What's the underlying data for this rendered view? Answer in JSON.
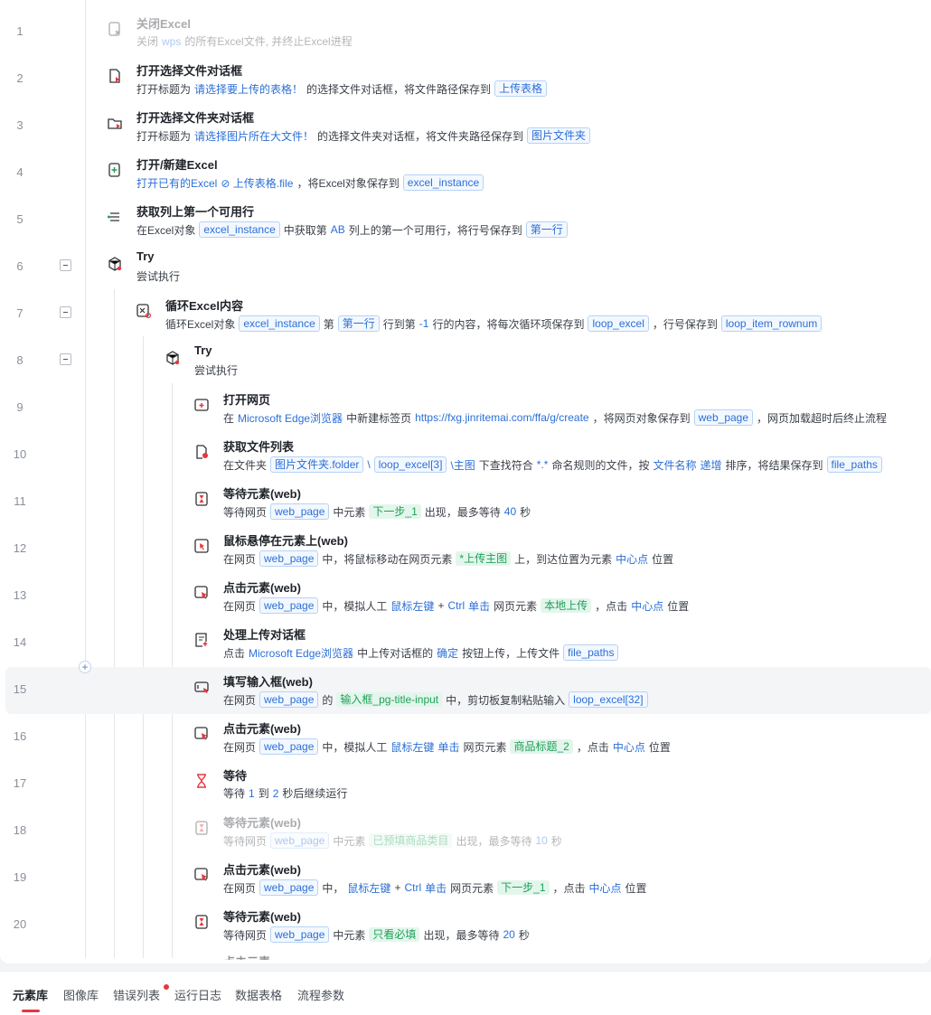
{
  "colors": {
    "variable": "#2b6fd6",
    "element": "#20a05a",
    "accent": "#e8363e"
  },
  "rows": [
    {
      "num": "1",
      "icon": "excel-close-icon",
      "title": "关闭Excel",
      "disabled": true,
      "desc": [
        {
          "t": "text",
          "v": "关闭"
        },
        {
          "t": "kw",
          "v": "wps"
        },
        {
          "t": "text",
          "v": "的所有Excel文件, 并终止Excel进程"
        }
      ]
    },
    {
      "num": "2",
      "icon": "file-dialog-icon",
      "title": "打开选择文件对话框",
      "desc": [
        {
          "t": "text",
          "v": "打开标题为"
        },
        {
          "t": "kw",
          "v": "请选择要上传的表格！"
        },
        {
          "t": "text",
          "v": "的选择文件对话框，将文件路径保存到"
        },
        {
          "t": "var",
          "v": "上传表格"
        }
      ]
    },
    {
      "num": "3",
      "icon": "folder-dialog-icon",
      "title": "打开选择文件夹对话框",
      "desc": [
        {
          "t": "text",
          "v": "打开标题为"
        },
        {
          "t": "kw",
          "v": "请选择图片所在大文件！"
        },
        {
          "t": "text",
          "v": "的选择文件夹对话框，将文件夹路径保存到"
        },
        {
          "t": "var",
          "v": "图片文件夹"
        }
      ]
    },
    {
      "num": "4",
      "icon": "excel-open-icon",
      "title": "打开/新建Excel",
      "desc": [
        {
          "t": "kw",
          "v": "打开已有的Excel"
        },
        {
          "t": "kw",
          "v": "⊘ 上传表格.file"
        },
        {
          "t": "text",
          "v": "，将Excel对象保存到"
        },
        {
          "t": "var",
          "v": "excel_instance"
        }
      ]
    },
    {
      "num": "5",
      "icon": "list-row-icon",
      "title": "获取列上第一个可用行",
      "desc": [
        {
          "t": "text",
          "v": "在Excel对象"
        },
        {
          "t": "var",
          "v": "excel_instance"
        },
        {
          "t": "text",
          "v": "中获取第"
        },
        {
          "t": "kw",
          "v": "AB"
        },
        {
          "t": "text",
          "v": "列上的第一个可用行，将行号保存到"
        },
        {
          "t": "var",
          "v": "第一行"
        }
      ]
    },
    {
      "num": "6",
      "icon": "try-cube-icon",
      "title": "Try",
      "collapse": true,
      "desc": [
        {
          "t": "text",
          "v": "尝试执行"
        }
      ]
    },
    {
      "num": "7",
      "icon": "loop-excel-icon",
      "title": "循环Excel内容",
      "collapse": true,
      "desc": [
        {
          "t": "text",
          "v": "循环Excel对象"
        },
        {
          "t": "var",
          "v": "excel_instance"
        },
        {
          "t": "text",
          "v": "第"
        },
        {
          "t": "var",
          "v": "第一行"
        },
        {
          "t": "text",
          "v": "行到第"
        },
        {
          "t": "kw",
          "v": "-1"
        },
        {
          "t": "text",
          "v": "行的内容，将每次循环项保存到"
        },
        {
          "t": "var",
          "v": "loop_excel"
        },
        {
          "t": "text",
          "v": "，行号保存到"
        },
        {
          "t": "var",
          "v": "loop_item_rownum"
        }
      ]
    },
    {
      "num": "8",
      "icon": "try-cube-icon",
      "title": "Try",
      "collapse": true,
      "desc": [
        {
          "t": "text",
          "v": "尝试执行"
        }
      ]
    },
    {
      "num": "9",
      "icon": "open-webpage-icon",
      "title": "打开网页",
      "desc": [
        {
          "t": "text",
          "v": "在"
        },
        {
          "t": "kw",
          "v": "Microsoft Edge浏览器"
        },
        {
          "t": "text",
          "v": "中新建标签页"
        },
        {
          "t": "kw",
          "v": "https://fxg.jinritemai.com/ffa/g/create"
        },
        {
          "t": "text",
          "v": "，将网页对象保存到"
        },
        {
          "t": "var",
          "v": "web_page"
        },
        {
          "t": "text",
          "v": "，网页加载超时后终止流程"
        }
      ]
    },
    {
      "num": "10",
      "icon": "file-list-icon",
      "title": "获取文件列表",
      "desc": [
        {
          "t": "text",
          "v": "在文件夹"
        },
        {
          "t": "var",
          "v": "图片文件夹.folder"
        },
        {
          "t": "kw",
          "v": "\\"
        },
        {
          "t": "var",
          "v": "loop_excel[3]"
        },
        {
          "t": "kw",
          "v": "\\主图"
        },
        {
          "t": "text",
          "v": "下查找符合"
        },
        {
          "t": "kw",
          "v": "*.*"
        },
        {
          "t": "text",
          "v": "命名规则的文件，按"
        },
        {
          "t": "kw",
          "v": "文件名称"
        },
        {
          "t": "kw",
          "v": "递增"
        },
        {
          "t": "text",
          "v": "排序，将结果保存到"
        },
        {
          "t": "var",
          "v": "file_paths"
        }
      ]
    },
    {
      "num": "11",
      "icon": "wait-element-icon",
      "title": "等待元素(web)",
      "desc": [
        {
          "t": "text",
          "v": "等待网页"
        },
        {
          "t": "var",
          "v": "web_page"
        },
        {
          "t": "text",
          "v": "中元素"
        },
        {
          "t": "el",
          "v": "下一步_1"
        },
        {
          "t": "text",
          "v": "出现，最多等待"
        },
        {
          "t": "kw",
          "v": "40"
        },
        {
          "t": "text",
          "v": "秒"
        }
      ]
    },
    {
      "num": "12",
      "icon": "mouse-hover-icon",
      "title": "鼠标悬停在元素上(web)",
      "desc": [
        {
          "t": "text",
          "v": "在网页"
        },
        {
          "t": "var",
          "v": "web_page"
        },
        {
          "t": "text",
          "v": "中，将鼠标移动在网页元素"
        },
        {
          "t": "el",
          "v": "*上传主图"
        },
        {
          "t": "text",
          "v": "上，到达位置为元素"
        },
        {
          "t": "kw",
          "v": "中心点"
        },
        {
          "t": "text",
          "v": "位置"
        }
      ]
    },
    {
      "num": "13",
      "icon": "click-element-icon",
      "title": "点击元素(web)",
      "desc": [
        {
          "t": "text",
          "v": "在网页"
        },
        {
          "t": "var",
          "v": "web_page"
        },
        {
          "t": "text",
          "v": "中，模拟人工"
        },
        {
          "t": "kw",
          "v": "鼠标左键"
        },
        {
          "t": "text",
          "v": "+"
        },
        {
          "t": "kw",
          "v": "Ctrl"
        },
        {
          "t": "kw",
          "v": "单击"
        },
        {
          "t": "text",
          "v": "网页元素"
        },
        {
          "t": "el",
          "v": "本地上传"
        },
        {
          "t": "text",
          "v": "，点击"
        },
        {
          "t": "kw",
          "v": "中心点"
        },
        {
          "t": "text",
          "v": "位置"
        }
      ]
    },
    {
      "num": "14",
      "icon": "upload-dialog-icon",
      "title": "处理上传对话框",
      "desc": [
        {
          "t": "text",
          "v": "点击"
        },
        {
          "t": "kw",
          "v": "Microsoft Edge浏览器"
        },
        {
          "t": "text",
          "v": "中上传对话框的"
        },
        {
          "t": "kw",
          "v": "确定"
        },
        {
          "t": "text",
          "v": "按钮上传，上传文件"
        },
        {
          "t": "var",
          "v": "file_paths"
        }
      ]
    },
    {
      "num": "15",
      "icon": "input-field-icon",
      "title": "填写输入框(web)",
      "highlight": true,
      "desc": [
        {
          "t": "text",
          "v": "在网页"
        },
        {
          "t": "var",
          "v": "web_page"
        },
        {
          "t": "text",
          "v": "的"
        },
        {
          "t": "el",
          "v": "输入框_pg-title-input"
        },
        {
          "t": "text",
          "v": "中，剪切板复制粘贴输入"
        },
        {
          "t": "var",
          "v": "loop_excel[32]"
        }
      ]
    },
    {
      "num": "16",
      "icon": "click-element-icon",
      "title": "点击元素(web)",
      "desc": [
        {
          "t": "text",
          "v": "在网页"
        },
        {
          "t": "var",
          "v": "web_page"
        },
        {
          "t": "text",
          "v": "中，模拟人工"
        },
        {
          "t": "kw",
          "v": "鼠标左键"
        },
        {
          "t": "kw",
          "v": "单击"
        },
        {
          "t": "text",
          "v": "网页元素"
        },
        {
          "t": "el",
          "v": "商品标题_2"
        },
        {
          "t": "text",
          "v": "，点击"
        },
        {
          "t": "kw",
          "v": "中心点"
        },
        {
          "t": "text",
          "v": "位置"
        }
      ]
    },
    {
      "num": "17",
      "icon": "hourglass-icon",
      "title": "等待",
      "desc": [
        {
          "t": "text",
          "v": "等待"
        },
        {
          "t": "kw",
          "v": "1"
        },
        {
          "t": "text",
          "v": "到"
        },
        {
          "t": "kw",
          "v": "2"
        },
        {
          "t": "text",
          "v": "秒后继续运行"
        }
      ]
    },
    {
      "num": "18",
      "icon": "wait-element-icon",
      "title": "等待元素(web)",
      "disabled": true,
      "desc": [
        {
          "t": "text",
          "v": "等待网页"
        },
        {
          "t": "var",
          "v": "web_page"
        },
        {
          "t": "text",
          "v": "中元素"
        },
        {
          "t": "el",
          "v": "已预填商品类目"
        },
        {
          "t": "text",
          "v": "出现，最多等待"
        },
        {
          "t": "kw",
          "v": "10"
        },
        {
          "t": "text",
          "v": "秒"
        }
      ]
    },
    {
      "num": "19",
      "icon": "click-element-icon",
      "title": "点击元素(web)",
      "desc": [
        {
          "t": "text",
          "v": "在网页"
        },
        {
          "t": "var",
          "v": "web_page"
        },
        {
          "t": "text",
          "v": "中，"
        },
        {
          "t": "kw",
          "v": "鼠标左键"
        },
        {
          "t": "text",
          "v": "+"
        },
        {
          "t": "kw",
          "v": "Ctrl"
        },
        {
          "t": "kw",
          "v": "单击"
        },
        {
          "t": "text",
          "v": "网页元素"
        },
        {
          "t": "el",
          "v": "下一步_1"
        },
        {
          "t": "text",
          "v": "，点击"
        },
        {
          "t": "kw",
          "v": "中心点"
        },
        {
          "t": "text",
          "v": "位置"
        }
      ]
    },
    {
      "num": "20",
      "icon": "wait-element-icon",
      "title": "等待元素(web)",
      "desc": [
        {
          "t": "text",
          "v": "等待网页"
        },
        {
          "t": "var",
          "v": "web_page"
        },
        {
          "t": "text",
          "v": "中元素"
        },
        {
          "t": "el",
          "v": "只看必填"
        },
        {
          "t": "text",
          "v": "出现，最多等待"
        },
        {
          "t": "kw",
          "v": "20"
        },
        {
          "t": "text",
          "v": "秒"
        }
      ]
    }
  ],
  "tabs": [
    {
      "label": "元素库",
      "active": true
    },
    {
      "label": "图像库"
    },
    {
      "label": "错误列表",
      "badge": true
    },
    {
      "label": "运行日志"
    },
    {
      "label": "数据表格"
    },
    {
      "label": "流程参数"
    }
  ]
}
